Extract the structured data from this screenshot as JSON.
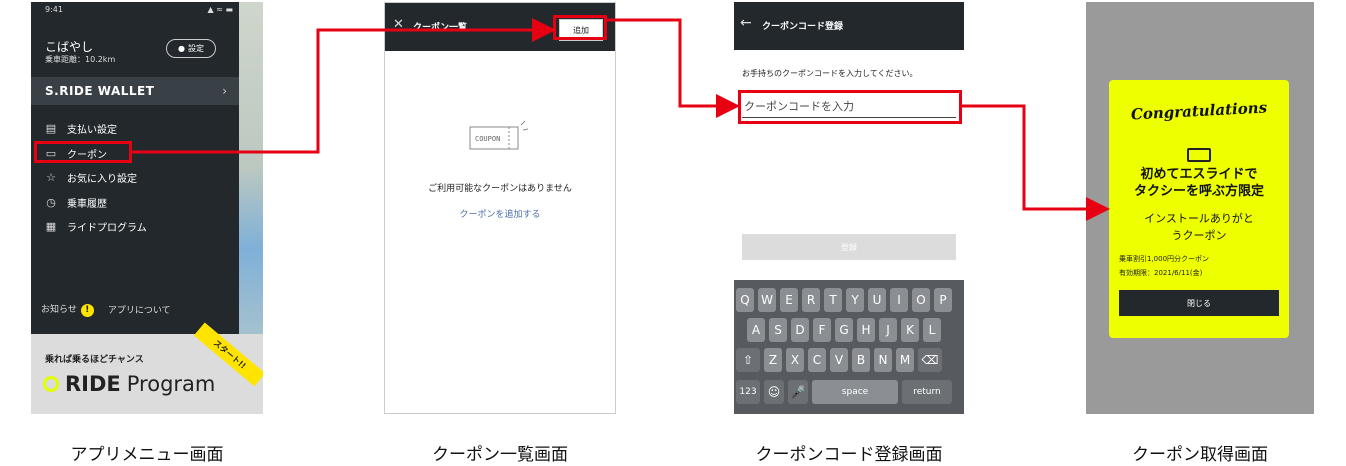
{
  "menu_screen": {
    "status_time": "9:41",
    "status_icons": "▲ ≈ ▬",
    "user_name": "こばやし",
    "distance": "乗車距離：10.2km",
    "settings_label": "設定",
    "wallet_label": "S.RIDE WALLET",
    "menu_items": [
      {
        "label": "支払い設定",
        "icon": "card-icon"
      },
      {
        "label": "クーポン",
        "icon": "coupon-icon"
      },
      {
        "label": "お気に入り設定",
        "icon": "star-icon"
      },
      {
        "label": "乗車履歴",
        "icon": "history-icon"
      },
      {
        "label": "ライドプログラム",
        "icon": "gift-icon"
      }
    ],
    "notice_label": "お知らせ",
    "notice_badge": "!",
    "about_label": "アプリについて",
    "program_tagline": "乗れば乗るほどチャンス",
    "program_logo_bold": "RIDE",
    "program_logo_rest": "Program",
    "start_ribbon": "スタート!!"
  },
  "coupon_list_screen": {
    "title": "クーポン一覧",
    "add_button": "追加",
    "illustration_text": "COUPON",
    "empty_message": "ご利用可能なクーポンはありません",
    "add_link": "クーポンを追加する"
  },
  "coupon_code_screen": {
    "title": "クーポンコード登録",
    "instruction": "お手持ちのクーポンコードを入力してください。",
    "input_placeholder": "クーポンコードを入力",
    "register_button": "登録",
    "keyboard": {
      "row1": [
        "Q",
        "W",
        "E",
        "R",
        "T",
        "Y",
        "U",
        "I",
        "O",
        "P"
      ],
      "row2": [
        "A",
        "S",
        "D",
        "F",
        "G",
        "H",
        "J",
        "K",
        "L"
      ],
      "row3": [
        "Z",
        "X",
        "C",
        "V",
        "B",
        "N",
        "M"
      ],
      "num_key": "123",
      "space_key": "space",
      "return_key": "return"
    }
  },
  "coupon_acquired_screen": {
    "congrats": "Congratulations",
    "headline_line1": "初めてエスライドで",
    "headline_line2": "タクシーを呼ぶ方限定",
    "sub_line1": "インストールありがと",
    "sub_line2": "うクーポン",
    "discount": "乗車割引1,000円分クーポン",
    "expiry": "有効期限：2021/6/11(金)",
    "close_button": "閉じる"
  },
  "captions": [
    "アプリメニュー画面",
    "クーポン一覧画面",
    "クーポンコード登録画面",
    "クーポン取得画面"
  ],
  "colors": {
    "highlight": "#e60012",
    "dark": "#22282c",
    "accent_yellow": "#eeff00"
  }
}
